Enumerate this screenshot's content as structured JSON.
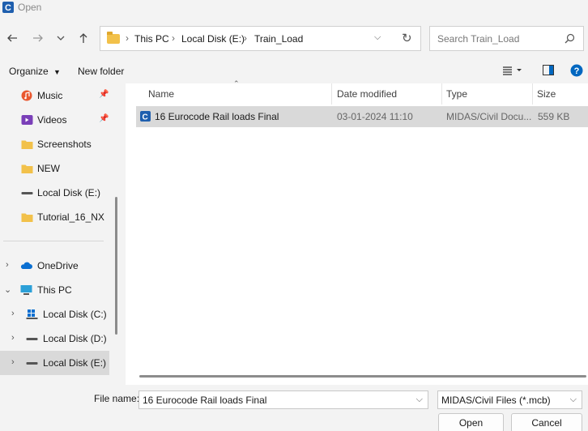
{
  "window": {
    "title": "Open"
  },
  "address": {
    "crumbs": [
      "This PC",
      "Local Disk (E:)",
      "Train_Load"
    ]
  },
  "search": {
    "placeholder": "Search Train_Load"
  },
  "toolbar": {
    "organize": "Organize",
    "new_folder": "New folder"
  },
  "sidebar": {
    "items": [
      {
        "label": "Music",
        "icon": "music-icon",
        "pinned": true
      },
      {
        "label": "Videos",
        "icon": "videos-icon",
        "pinned": true
      },
      {
        "label": "Screenshots",
        "icon": "folder-icon"
      },
      {
        "label": "NEW",
        "icon": "folder-icon"
      },
      {
        "label": "Local Disk (E:)",
        "icon": "drive-icon"
      },
      {
        "label": "Tutorial_16_NX",
        "icon": "folder-icon"
      },
      {
        "label": "OneDrive",
        "icon": "cloud-icon"
      },
      {
        "label": "This PC",
        "icon": "pc-icon"
      },
      {
        "label": "Local Disk (C:)",
        "icon": "windows-drive-icon"
      },
      {
        "label": "Local Disk (D:)",
        "icon": "drive-icon"
      },
      {
        "label": "Local Disk (E:)",
        "icon": "drive-icon",
        "selected": true
      }
    ]
  },
  "columns": {
    "name": "Name",
    "date": "Date modified",
    "type": "Type",
    "size": "Size"
  },
  "files": [
    {
      "name": "16 Eurocode Rail loads Final",
      "date": "03-01-2024 11:10",
      "type": "MIDAS/Civil Docu...",
      "size": "559 KB"
    }
  ],
  "footer": {
    "file_name_label": "File name:",
    "file_name_value": "16 Eurocode Rail loads Final",
    "filter_value": "MIDAS/Civil Files (*.mcb)",
    "open_label": "Open",
    "cancel_label": "Cancel"
  },
  "colors": {
    "accent": "#0067c0",
    "selection": "#d9d9d9",
    "folder": "#f2c14a"
  }
}
